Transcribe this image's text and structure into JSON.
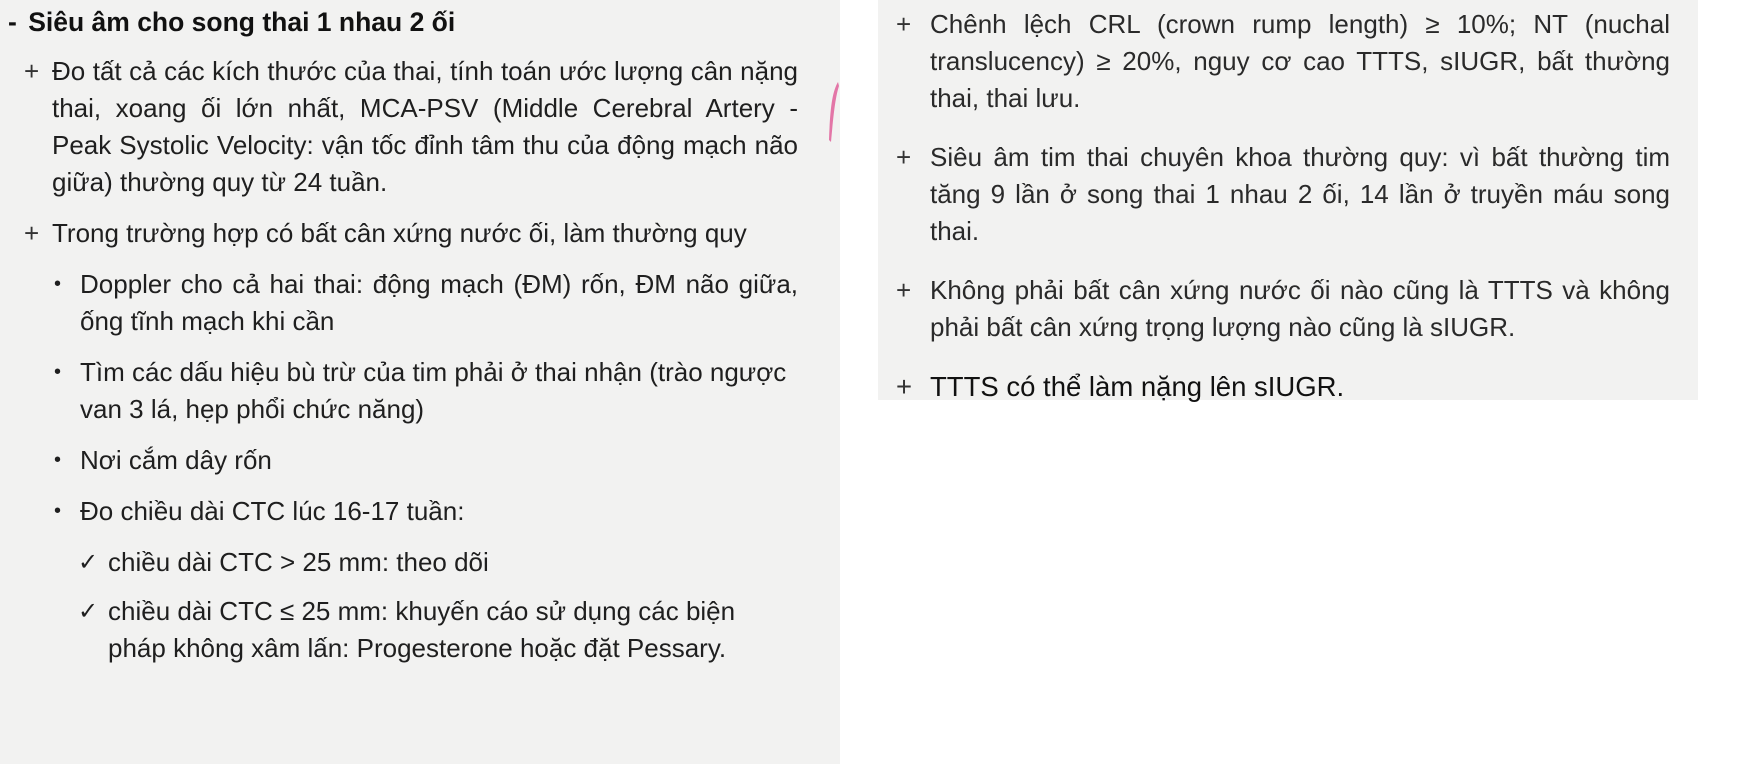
{
  "left": {
    "heading_dash": "-",
    "heading": "Siêu âm cho song thai 1 nhau 2 ối",
    "items": [
      {
        "marker": "+",
        "text": "Đo tất cả các kích thước của thai, tính toán ước lượng cân nặng thai, xoang ối lớn nhất, MCA-PSV (Middle Cerebral Artery - Peak Systolic Velocity: vận tốc đỉnh tâm thu của động mạch não giữa) thường quy từ 24 tuần."
      },
      {
        "marker": "+",
        "text": "Trong trường hợp có bất cân xứng nước ối, làm thường quy"
      }
    ],
    "bullets": [
      {
        "marker": "•",
        "text": "Doppler cho cả hai thai: động mạch (ĐM) rốn, ĐM não giữa, ống tĩnh mạch khi cần"
      },
      {
        "marker": "•",
        "text": "Tìm các dấu hiệu bù trừ của tim phải ở thai nhận (trào ngược van 3 lá, hẹp phổi chức năng)"
      },
      {
        "marker": "•",
        "text": "Nơi cắm dây rốn"
      },
      {
        "marker": "•",
        "text": "Đo chiều dài CTC lúc 16-17 tuần:"
      }
    ],
    "checks": [
      {
        "marker": "✓",
        "text": "chiều dài CTC > 25 mm: theo dõi"
      },
      {
        "marker": "✓",
        "text": "chiều dài CTC ≤ 25 mm: khuyến cáo sử dụng các biện pháp không xâm lấn: Progesterone hoặc đặt Pessary."
      }
    ]
  },
  "right": {
    "items": [
      {
        "marker": "+",
        "text": "Chênh lệch CRL (crown rump length) ≥ 10%; NT (nuchal translucency) ≥ 20%, nguy cơ cao TTTS, sIUGR, bất thường thai, thai lưu."
      },
      {
        "marker": "+",
        "text": "Siêu âm tim thai chuyên khoa thường quy: vì bất thường tim tăng 9 lần ở song thai 1 nhau 2 ối, 14 lần ở truyền máu song thai."
      },
      {
        "marker": "+",
        "text": "Không phải bất cân xứng nước ối nào cũng là TTTS và không phải bất cân xứng trọng lượng nào cũng là sIUGR."
      },
      {
        "marker": "+",
        "text": "TTTS có thể làm nặng lên sIUGR."
      }
    ]
  },
  "colors": {
    "panel_bg": "#f2f2f1",
    "text": "#1f1f1f",
    "pink_mark": "#e0609a"
  }
}
